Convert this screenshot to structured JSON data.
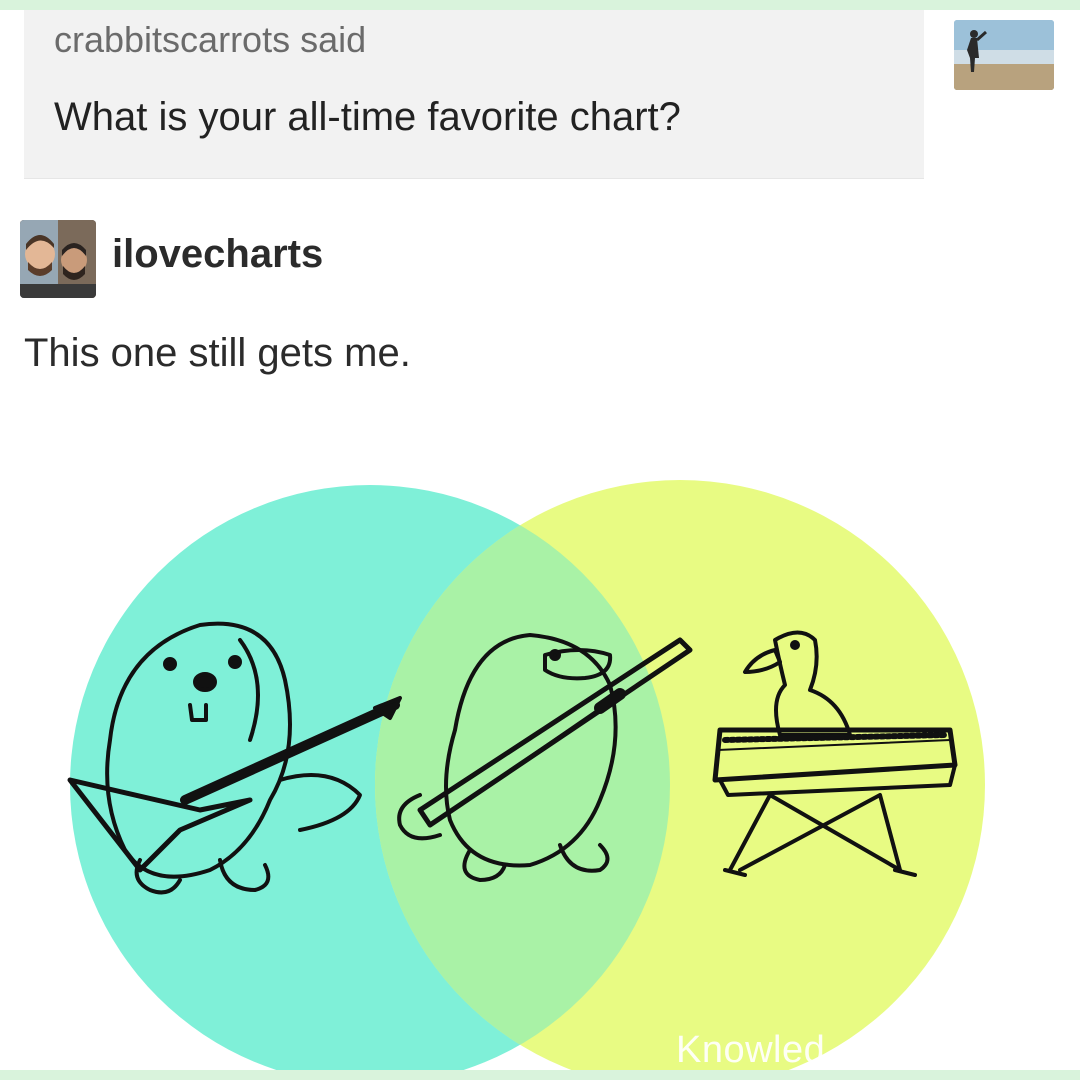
{
  "question_post": {
    "asker_line": "crabbitscarrots said",
    "question": "What is your all-time favorite chart?",
    "asker_avatar_icon": "beach-person-photo-icon"
  },
  "answer_post": {
    "username": "ilovecharts",
    "avatar_icon": "two-men-selfie-photo-icon",
    "text": "This one still gets me."
  },
  "venn_diagram": {
    "sets": [
      {
        "subject": "beaver-playing-keytar-guitar",
        "color": "#7ff0d8"
      },
      {
        "subject": "duck-playing-keyboard",
        "color": "#e8fb83"
      }
    ],
    "intersection": {
      "subject": "platypus-playing-keytar",
      "color": "#a9f2a6"
    }
  },
  "watermark": {
    "text": "Knowled"
  },
  "colors": {
    "border": "#d9f3dc",
    "ask_background": "#f2f2f2",
    "text_dark": "#222222",
    "text_muted": "#6b6b6b"
  }
}
